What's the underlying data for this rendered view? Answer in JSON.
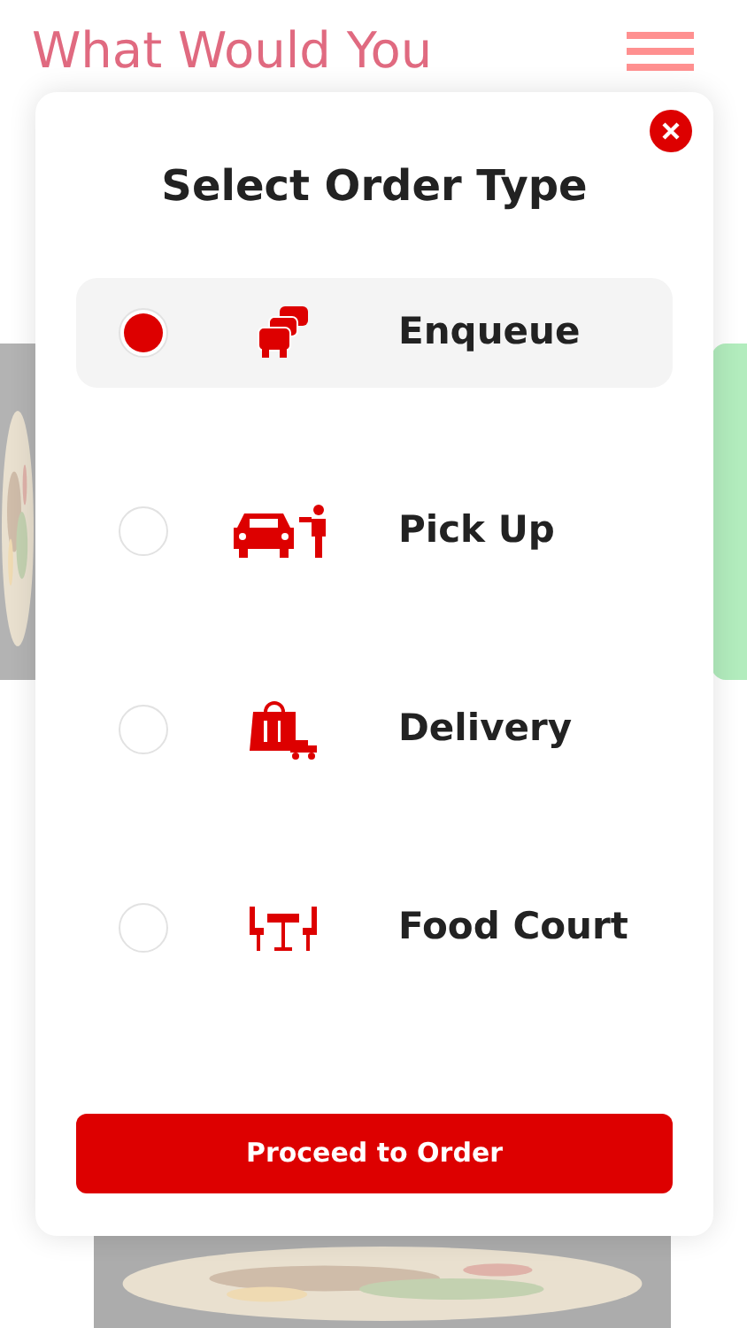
{
  "background": {
    "heading": "What Would You"
  },
  "dialog": {
    "title": "Select Order Type",
    "options": [
      {
        "label": "Enqueue",
        "kind": "queue",
        "selected": true
      },
      {
        "label": "Pick Up",
        "kind": "pickup",
        "selected": false
      },
      {
        "label": "Delivery",
        "kind": "delivery",
        "selected": false
      },
      {
        "label": "Food Court",
        "kind": "court",
        "selected": false
      }
    ],
    "button": "Proceed to Order"
  }
}
